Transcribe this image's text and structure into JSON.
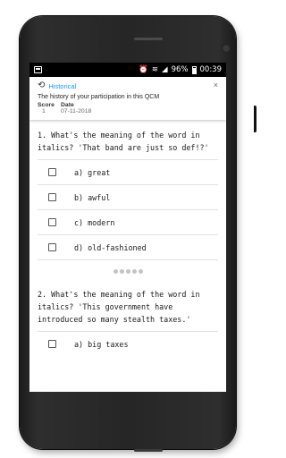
{
  "status_bar": {
    "battery": "96%",
    "time": "00:39",
    "icons": [
      "notification-icon",
      "alarm-icon",
      "wifi-icon",
      "signal-icon",
      "battery-icon"
    ]
  },
  "history": {
    "title": "Historical",
    "subtitle": "The history of your participation in this QCM",
    "score_header": "Score",
    "date_header": "Date",
    "score": "1",
    "date": "07-11-2018",
    "close": "×"
  },
  "questions": [
    {
      "text": "1. What's the meaning of the word in italics? 'That band are just so def!?'",
      "options": [
        "a) great",
        "b) awful",
        "c) modern",
        "d) old-fashioned"
      ]
    },
    {
      "text": "2. What's the meaning of the word in italics? 'This government have introduced so many stealth taxes.'",
      "options": [
        "a) big taxes"
      ]
    }
  ],
  "colors": {
    "accent": "#2196f3",
    "status_bar": "#000000",
    "text": "#1a1a1a"
  }
}
